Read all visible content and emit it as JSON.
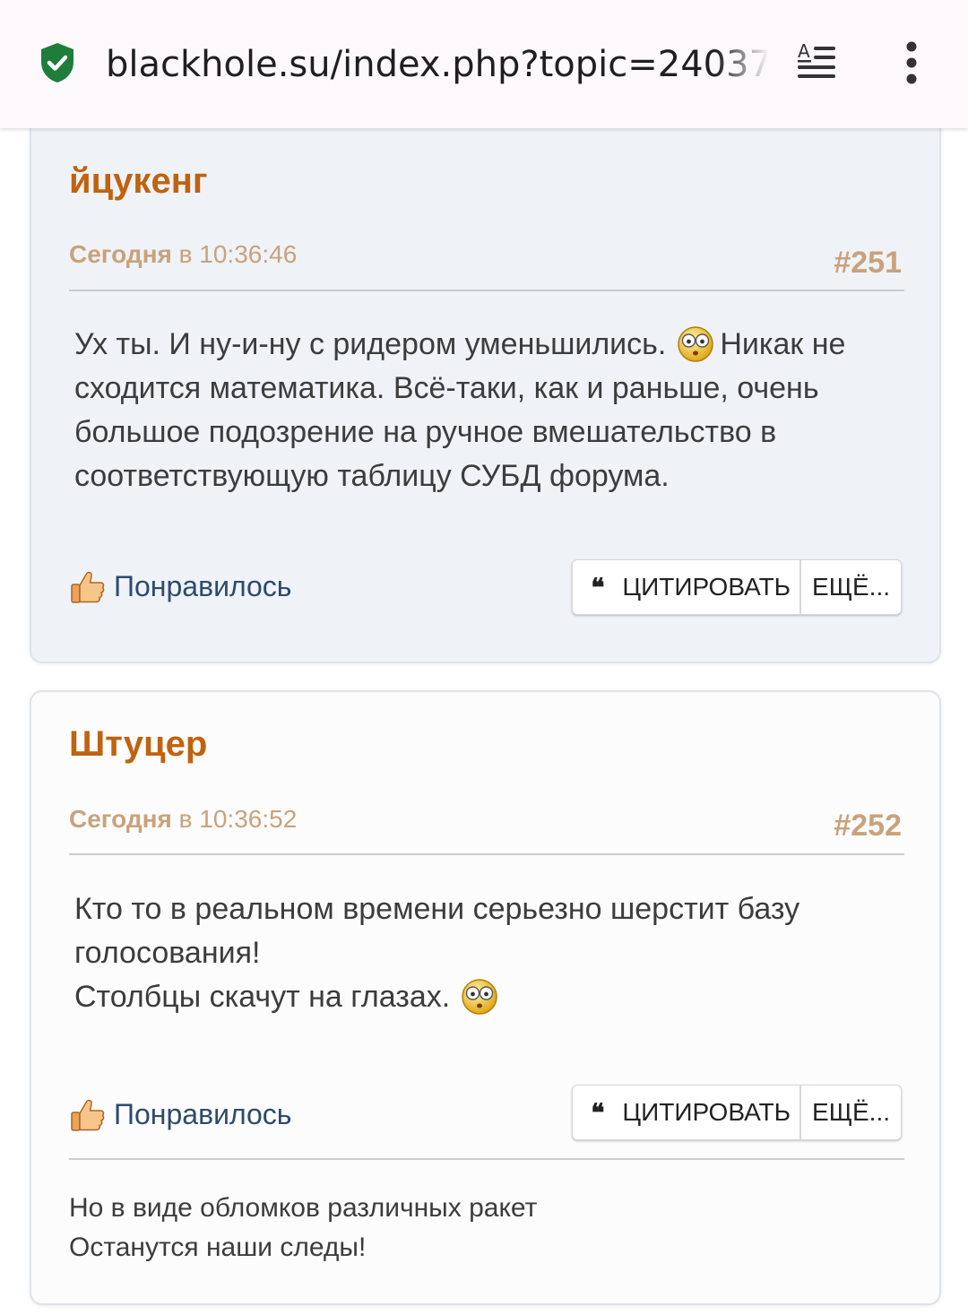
{
  "browser": {
    "url": "blackhole.su/index.php?topic=24037",
    "icons": {
      "security": "shield-check-icon",
      "reader": "reader-mode-icon",
      "menu": "kebab-menu-icon"
    },
    "colors": {
      "shield": "#1e7d3b"
    }
  },
  "posts": [
    {
      "author": "йцукенг",
      "date_word": "Сегодня",
      "time_prefix": " в ",
      "time": "10:36:46",
      "number": "#251",
      "body_lines": [
        "Ух ты. И ну-и-ну с ридером уменьшились.",
        "Никак не",
        "сходится математика. Всё-таки, как и раньше, очень",
        "большое подозрение на ручное вмешательство в",
        "соответствующую таблицу СУБД форума."
      ],
      "smiley": "shocked-smiley-icon",
      "like_label": "Понравилось",
      "quote_mark": "❝",
      "quote_label": "ЦИТИРОВАТЬ",
      "more_label": "ЕЩЁ..."
    },
    {
      "author": "Штуцер",
      "date_word": "Сегодня",
      "time_prefix": " в ",
      "time": "10:36:52",
      "number": "#252",
      "body_lines": [
        "Кто то в реальном времени серьезно шерстит базу",
        "голосования!",
        "Столбцы скачут на глазах."
      ],
      "smiley": "shocked-smiley-icon",
      "like_label": "Понравилось",
      "quote_mark": "❝",
      "quote_label": "ЦИТИРОВАТЬ",
      "more_label": "ЕЩЁ...",
      "signature_lines": [
        "Но в виде обломков различных ракет",
        "Останутся наши следы!"
      ]
    }
  ],
  "colors": {
    "author": "#c0620f",
    "meta": "#c9a27c",
    "like_text": "#2e4a6e",
    "post1_bg": "#eff3f7",
    "post2_bg": "#fcfcfc"
  }
}
